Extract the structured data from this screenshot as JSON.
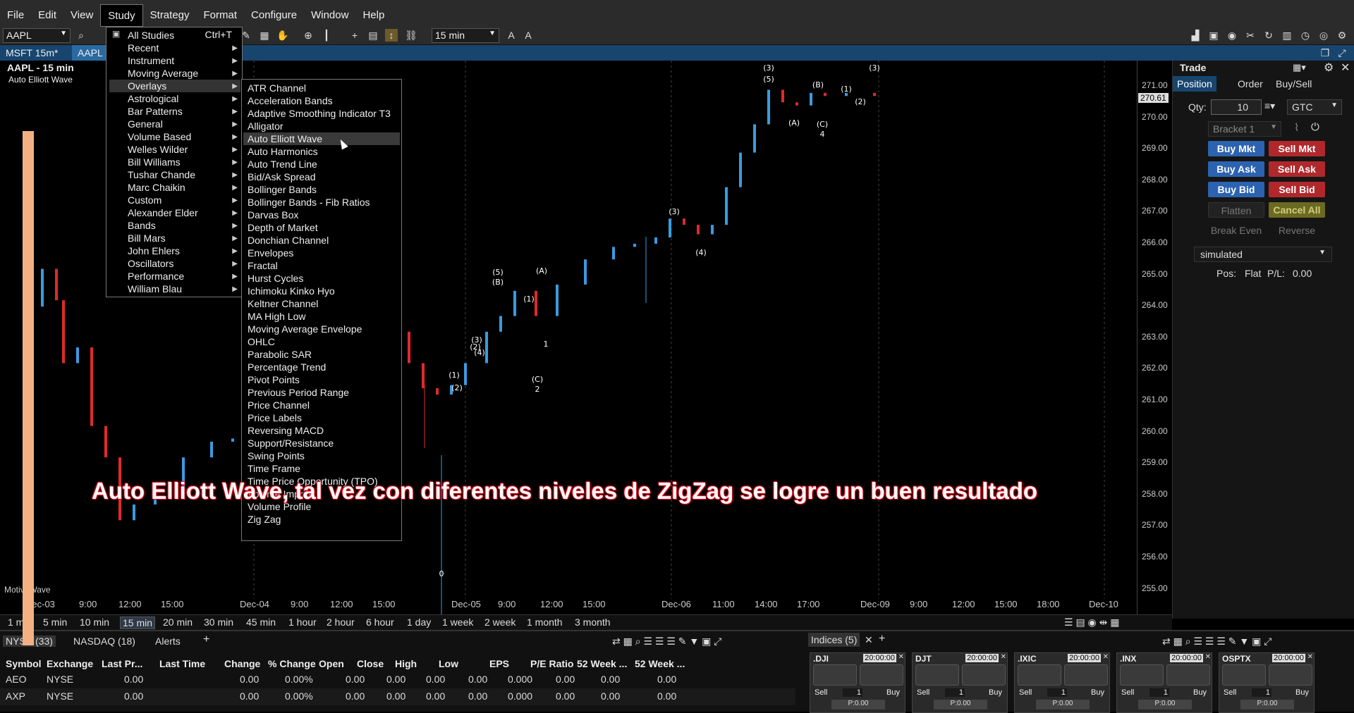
{
  "menubar": {
    "items": [
      "File",
      "Edit",
      "View",
      "Study",
      "Strategy",
      "Format",
      "Configure",
      "Window",
      "Help"
    ],
    "active": "Study"
  },
  "toolbar": {
    "symbol": "AAPL",
    "bar_size": "15 min"
  },
  "chart_tabs": [
    "MSFT 15m*",
    "AAPL"
  ],
  "chart": {
    "symbol_label": "AAPL - 15 min",
    "study_label": "Auto Elliott Wave",
    "watermark": "MotiveWave",
    "last_price": "270.61",
    "price_ticks": [
      "271.00",
      "270.00",
      "269.00",
      "268.00",
      "267.00",
      "266.00",
      "265.00",
      "264.00",
      "263.00",
      "262.00",
      "261.00",
      "260.00",
      "259.00",
      "258.00",
      "257.00",
      "256.00",
      "255.00"
    ],
    "time_ticks": [
      "Dec-03",
      "9:00",
      "12:00",
      "15:00",
      "Dec-04",
      "9:00",
      "12:00",
      "15:00",
      "Dec-05",
      "9:00",
      "12:00",
      "15:00",
      "Dec-06",
      "11:00",
      "14:00",
      "17:00",
      "Dec-09",
      "9:00",
      "12:00",
      "15:00",
      "18:00",
      "Dec-10"
    ],
    "wave_labels": [
      "(3)",
      "(5)",
      "(B)",
      "(1)",
      "(2)",
      "(A)",
      "(C)",
      "4",
      "(3)",
      "(3)",
      "(4)",
      "1",
      "(5)",
      "(B)",
      "(1)",
      "(A)",
      "(2)",
      "(3)",
      "(4)",
      "(1)",
      "(2)",
      "(C)",
      "2",
      "0"
    ]
  },
  "bar_sizes": [
    "1 m",
    "5 min",
    "10 min",
    "15 min",
    "20 min",
    "30 min",
    "45 min",
    "1 hour",
    "2 hour",
    "6 hour",
    "1 day",
    "1 week",
    "2 week",
    "1 month",
    "3 month"
  ],
  "bar_size_selected": "15 min",
  "study_menu": {
    "items": [
      {
        "label": "All Studies",
        "shortcut": "Ctrl+T"
      },
      {
        "label": "Recent"
      },
      {
        "label": "Instrument"
      },
      {
        "label": "Moving Average"
      },
      {
        "label": "Overlays"
      },
      {
        "label": "Astrological"
      },
      {
        "label": "Bar Patterns"
      },
      {
        "label": "General"
      },
      {
        "label": "Volume Based"
      },
      {
        "label": "Welles Wilder"
      },
      {
        "label": "Bill Williams"
      },
      {
        "label": "Tushar Chande"
      },
      {
        "label": "Marc Chaikin"
      },
      {
        "label": "Custom"
      },
      {
        "label": "Alexander Elder"
      },
      {
        "label": "Bands"
      },
      {
        "label": "Bill Mars"
      },
      {
        "label": "John Ehlers"
      },
      {
        "label": "Oscillators"
      },
      {
        "label": "Performance"
      },
      {
        "label": "William Blau"
      }
    ],
    "highlighted": "Overlays"
  },
  "overlay_menu": {
    "items": [
      "ATR Channel",
      "Acceleration Bands",
      "Adaptive Smoothing Indicator T3",
      "Alligator",
      "Auto Elliott Wave",
      "Auto Harmonics",
      "Auto Trend Line",
      "Bid/Ask Spread",
      "Bollinger Bands",
      "Bollinger Bands - Fib Ratios",
      "Darvas Box",
      "Depth of Market",
      "Donchian Channel",
      "Envelopes",
      "Fractal",
      "Hurst Cycles",
      "Ichimoku Kinko Hyo",
      "Keltner Channel",
      "MA High Low",
      "Moving Average Envelope",
      "OHLC",
      "Parabolic SAR",
      "Percentage Trend",
      "Pivot Points",
      "Previous Period Range",
      "Price Channel",
      "Price Labels",
      "Reversing MACD",
      "Support/Resistance",
      "Swing Points",
      "Time Frame",
      "Time Price Opportunity (TPO)",
      "Volume Imprint",
      "Volume Profile",
      "Zig Zag"
    ],
    "highlighted": "Auto Elliott Wave"
  },
  "caption": "Auto Elliott Wave, tal vez con diferentes niveles de ZigZag se logre un buen resultado",
  "trade": {
    "title": "Trade",
    "tabs": [
      "Position",
      "Order",
      "Buy/Sell"
    ],
    "qty_label": "Qty:",
    "qty": "10",
    "tif": "GTC",
    "bracket": "Bracket 1",
    "buttons": {
      "buy_mkt": "Buy Mkt",
      "sell_mkt": "Sell Mkt",
      "buy_ask": "Buy Ask",
      "sell_ask": "Sell Ask",
      "buy_bid": "Buy Bid",
      "sell_bid": "Sell Bid",
      "flatten": "Flatten",
      "cancel_all": "Cancel All",
      "break_even": "Break Even",
      "reverse": "Reverse"
    },
    "account": "simulated",
    "pos_label": "Pos:",
    "pos_value": "Flat",
    "pl_label": "P/L:",
    "pl_value": "0.00"
  },
  "watchlist": {
    "tabs": [
      "NYSE (33)",
      "NASDAQ (18)",
      "Alerts",
      "+"
    ],
    "columns": [
      "Symbol",
      "Exchange",
      "Last Pr...",
      "Last Time",
      "Change",
      "% Change",
      "Open",
      "Close",
      "High",
      "Low",
      "EPS",
      "P/E Ratio",
      "52 Week ...",
      "52 Week ..."
    ],
    "rows": [
      [
        "AEO",
        "NYSE",
        "0.00",
        "",
        "0.00",
        "0.00%",
        "0.00",
        "0.00",
        "0.00",
        "0.00",
        "0.000",
        "0.00",
        "0.00",
        "0.00"
      ],
      [
        "AXP",
        "NYSE",
        "0.00",
        "",
        "0.00",
        "0.00%",
        "0.00",
        "0.00",
        "0.00",
        "0.00",
        "0.000",
        "0.00",
        "0.00",
        "0.00"
      ]
    ]
  },
  "indices": {
    "tab": "Indices (5)",
    "cards": [
      {
        "name": ".DJI",
        "time": "20:00:00"
      },
      {
        "name": "DJT",
        "time": "20:00:00"
      },
      {
        "name": ".IXIC",
        "time": "20:00:00"
      },
      {
        "name": ".INX",
        "time": "20:00:00"
      },
      {
        "name": "OSPTX",
        "time": "20:00:00"
      }
    ],
    "sell": "Sell",
    "buy": "Buy",
    "qty": "1",
    "pl": "P:0.00"
  },
  "colors": {
    "up": "#3a9be0",
    "down": "#e02a2a",
    "panel": "#2b2b2b",
    "tab_blue": "#17456e"
  }
}
